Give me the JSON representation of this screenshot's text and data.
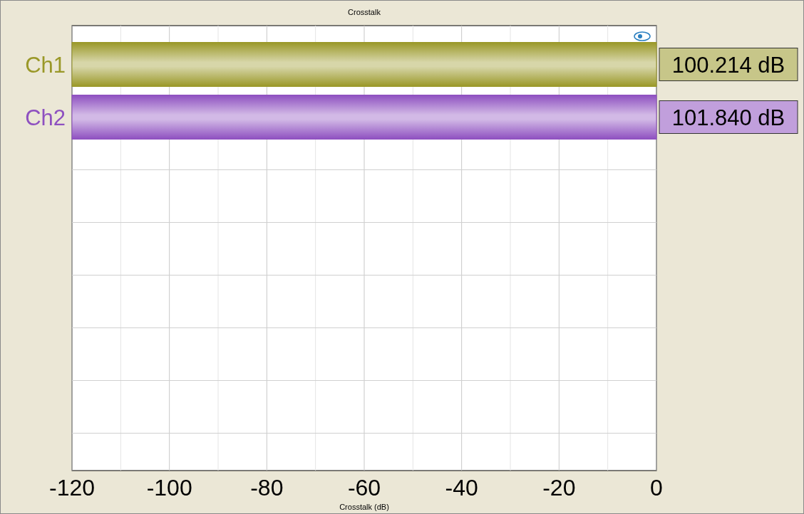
{
  "chart_data": {
    "type": "bar",
    "orientation": "horizontal",
    "title": "Crosstalk",
    "xlabel": "Crosstalk (dB)",
    "xlim": [
      -120,
      0
    ],
    "xticks": [
      -120,
      -100,
      -80,
      -60,
      -40,
      -20,
      0
    ],
    "grid": true,
    "series": [
      {
        "name": "Ch1",
        "color": "#9a9828",
        "values": [
          -120
        ]
      },
      {
        "name": "Ch2",
        "color": "#8e50c0",
        "values": [
          -120
        ]
      }
    ],
    "value_labels": [
      "100.214 dB",
      "101.840 dB"
    ]
  }
}
